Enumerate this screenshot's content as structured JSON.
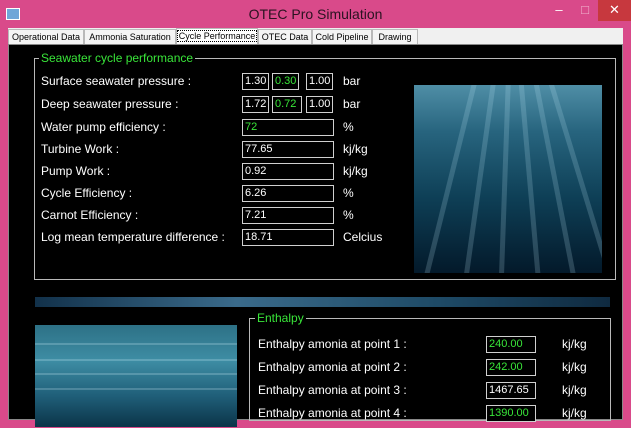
{
  "window": {
    "title": "OTEC Pro Simulation",
    "minimize_glyph": "–",
    "maximize_glyph": "□",
    "close_glyph": "✕"
  },
  "tabs": [
    {
      "label": "Operational Data"
    },
    {
      "label": "Ammonia Saturation"
    },
    {
      "label": "Cycle Performance",
      "active": true
    },
    {
      "label": "OTEC Data"
    },
    {
      "label": "Cold Pipeline"
    },
    {
      "label": "Drawing"
    }
  ],
  "seawater": {
    "title": "Seawater cycle performance",
    "rows": [
      {
        "label": "Surface seawater pressure :",
        "values": [
          {
            "text": "1.30",
            "green": false
          },
          {
            "text": "0.30",
            "green": true
          },
          {
            "text": "1.00",
            "green": false
          }
        ],
        "unit": "bar"
      },
      {
        "label": "Deep seawater pressure :",
        "values": [
          {
            "text": "1.72",
            "green": false
          },
          {
            "text": "0.72",
            "green": true
          },
          {
            "text": "1.00",
            "green": false
          }
        ],
        "unit": "bar"
      },
      {
        "label": "Water pump efficiency :",
        "value": "72",
        "green": true,
        "unit": "%"
      },
      {
        "label": "Turbine Work :",
        "value": "77.65",
        "green": false,
        "unit": "kj/kg"
      },
      {
        "label": "Pump Work :",
        "value": "0.92",
        "green": false,
        "unit": "kj/kg"
      },
      {
        "label": "Cycle Efficiency :",
        "value": "6.26",
        "green": false,
        "unit": "%"
      },
      {
        "label": "Carnot Efficiency :",
        "value": "7.21",
        "green": false,
        "unit": "%"
      },
      {
        "label": "Log mean temperature difference :",
        "value": "18.71",
        "green": false,
        "unit": "Celcius"
      }
    ]
  },
  "enthalpy": {
    "title": "Enthalpy",
    "rows": [
      {
        "label": "Enthalpy amonia at point 1 :",
        "value": "240.00",
        "green": true,
        "unit": "kj/kg"
      },
      {
        "label": "Enthalpy amonia at point 2 :",
        "value": "242.00",
        "green": true,
        "unit": "kj/kg"
      },
      {
        "label": "Enthalpy amonia at point 3 :",
        "value": "1467.65",
        "green": false,
        "unit": "kj/kg"
      },
      {
        "label": "Enthalpy amonia at point 4 :",
        "value": "1390.00",
        "green": true,
        "unit": "kj/kg"
      }
    ]
  },
  "colors": {
    "titlebar": "#d94a8a",
    "accent_green": "#39e639",
    "panel_background": "#000000",
    "close_button": "#c7383e"
  },
  "icons": {
    "app": "app-icon",
    "minimize": "minimize-icon",
    "maximize": "maximize-icon",
    "close": "close-icon"
  }
}
